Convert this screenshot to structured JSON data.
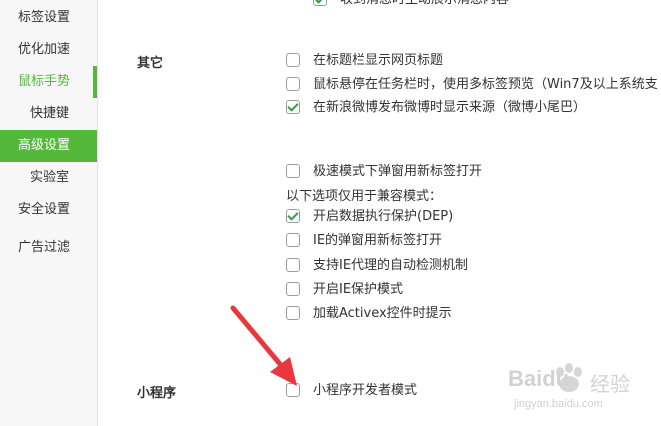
{
  "sidebar": {
    "items": [
      {
        "label": "标签设置"
      },
      {
        "label": "优化加速"
      },
      {
        "label": "鼠标手势"
      },
      {
        "label": "快捷键"
      },
      {
        "label": "高级设置"
      },
      {
        "label": "实验室"
      },
      {
        "label": "安全设置"
      },
      {
        "label": "广告过滤"
      }
    ]
  },
  "main": {
    "top_partial_option": "收到消息时主动展示消息内容",
    "other": {
      "label": "其它",
      "options": [
        {
          "text": "在标题栏显示网页标题",
          "checked": false
        },
        {
          "text": "鼠标悬停在任务栏时，使用多标签预览（Win7及以上系统支",
          "checked": false
        },
        {
          "text": "在新浪微博发布微博时显示来源（微博小尾巴）",
          "checked": true
        }
      ]
    },
    "compat": {
      "speed_option": {
        "text": "极速模式下弹窗用新标签打开",
        "checked": false
      },
      "note": "以下选项仅用于兼容模式：",
      "options": [
        {
          "text": "开启数据执行保护(DEP)",
          "checked": true
        },
        {
          "text": "IE的弹窗用新标签打开",
          "checked": false
        },
        {
          "text": "支持IE代理的自动检测机制",
          "checked": false
        },
        {
          "text": "开启IE保护模式",
          "checked": false
        },
        {
          "text": "加载Activex控件时提示",
          "checked": false
        }
      ]
    },
    "mini": {
      "label": "小程序",
      "option": {
        "text": "小程序开发者模式",
        "checked": false
      }
    }
  },
  "watermark": {
    "brand": "Baidu",
    "suffix": "经验",
    "url": "jingyan.baidu.com"
  },
  "colors": {
    "accent": "#54b83a",
    "arrow": "#e8383d"
  }
}
